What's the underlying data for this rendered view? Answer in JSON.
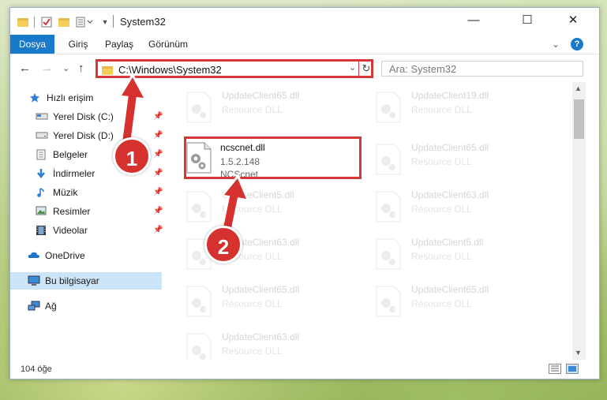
{
  "window": {
    "title": "System32",
    "controls": {
      "minimize": "—",
      "maximize": "☐",
      "close": "✕"
    }
  },
  "ribbon": {
    "tabs": [
      "Dosya",
      "Giriş",
      "Paylaş",
      "Görünüm"
    ],
    "expand_glyph": "⌄",
    "help_glyph": "?"
  },
  "navbar": {
    "back": "←",
    "forward": "→",
    "recent": "⌄",
    "up": "↑",
    "address": "C:\\Windows\\System32",
    "address_dropdown": "⌄",
    "refresh": "↻",
    "search_placeholder": "Ara: System32"
  },
  "sidebar": {
    "quick_access": "Hızlı erişim",
    "items": [
      {
        "label": "Yerel Disk (C:)",
        "icon": "drive-icon",
        "pinned": true
      },
      {
        "label": "Yerel Disk (D:)",
        "icon": "drive-icon",
        "pinned": true
      },
      {
        "label": "Belgeler",
        "icon": "documents-icon",
        "pinned": true
      },
      {
        "label": "İndirmeler",
        "icon": "downloads-icon",
        "pinned": true
      },
      {
        "label": "Müzik",
        "icon": "music-icon",
        "pinned": true
      },
      {
        "label": "Resimler",
        "icon": "pictures-icon",
        "pinned": true
      },
      {
        "label": "Videolar",
        "icon": "videos-icon",
        "pinned": true
      }
    ],
    "onedrive": "OneDrive",
    "this_pc": "Bu bilgisayar",
    "network": "Ağ",
    "pin_glyph": "📌"
  },
  "files": {
    "highlighted": {
      "name": "ncscnet.dll",
      "version": "1.5.2.148",
      "description": "NCScnet"
    },
    "background": [
      {
        "name": "UpdateClient65.dll",
        "type": "Resource DLL"
      },
      {
        "name": "UpdateClient19.dll",
        "type": "Resource DLL"
      },
      {
        "name": "UpdateClient65.dll",
        "type": "Resource DLL"
      },
      {
        "name": "UpdateClient5.dll",
        "type": "Resource DLL"
      },
      {
        "name": "UpdateClient63.dll",
        "type": "Resource DLL"
      },
      {
        "name": "UpdateClient63.dll",
        "type": "Resource DLL"
      },
      {
        "name": "UpdateClient5.dll",
        "type": "Resource DLL"
      },
      {
        "name": "UpdateClient65.dll",
        "type": "Resource DLL"
      },
      {
        "name": "UpdateClient65.dll",
        "type": "Resource DLL"
      },
      {
        "name": "UpdateClient63.dll",
        "type": "Resource DLL"
      }
    ]
  },
  "status": {
    "item_count": "104 öğe"
  },
  "annotations": {
    "step1": "1",
    "step2": "2"
  },
  "colors": {
    "accent": "#1979ca",
    "highlight": "#d9383b",
    "selection": "#cce4f7"
  }
}
